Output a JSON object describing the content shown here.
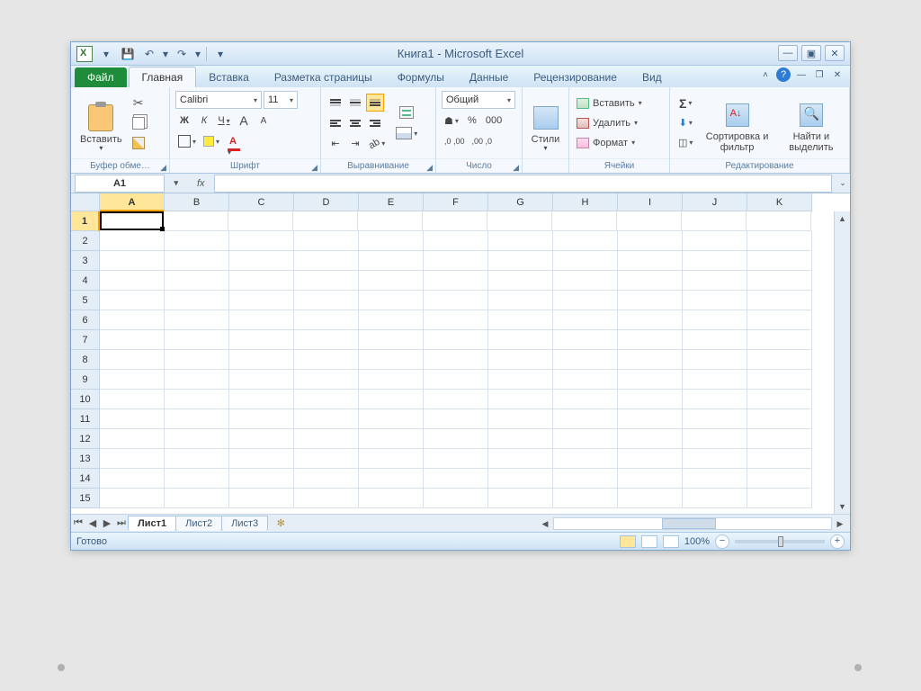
{
  "title": "Книга1  -  Microsoft Excel",
  "ribbon": {
    "tabs": {
      "file": "Файл",
      "home": "Главная",
      "insert": "Вставка",
      "page_layout": "Разметка страницы",
      "formulas": "Формулы",
      "data": "Данные",
      "review": "Рецензирование",
      "view": "Вид"
    },
    "groups": {
      "clipboard": {
        "label": "Буфер обме…",
        "paste": "Вставить"
      },
      "font": {
        "label": "Шрифт",
        "font_name": "Calibri",
        "font_size": "11",
        "bold": "Ж",
        "italic": "К",
        "underline": "Ч",
        "grow": "A",
        "shrink": "A"
      },
      "alignment": {
        "label": "Выравнивание"
      },
      "number": {
        "label": "Число",
        "format": "Общий",
        "percent": "%",
        "thousands": "000",
        "inc_dec_a": ",0←",
        "inc_dec_b": ",00→"
      },
      "styles": {
        "label": "",
        "button": "Стили"
      },
      "cells": {
        "label": "Ячейки",
        "insert": "Вставить",
        "delete": "Удалить",
        "format": "Формат"
      },
      "editing": {
        "label": "Редактирование",
        "sigma": "Σ",
        "sort": "Сортировка и фильтр",
        "find": "Найти и выделить"
      }
    }
  },
  "formula_bar": {
    "name_box": "A1",
    "fx": "fx",
    "formula": ""
  },
  "grid": {
    "columns": [
      "A",
      "B",
      "C",
      "D",
      "E",
      "F",
      "G",
      "H",
      "I",
      "J",
      "K"
    ],
    "rows": [
      "1",
      "2",
      "3",
      "4",
      "5",
      "6",
      "7",
      "8",
      "9",
      "10",
      "11",
      "12",
      "13",
      "14",
      "15"
    ],
    "active_cell": "A1"
  },
  "sheets": {
    "tabs": [
      "Лист1",
      "Лист2",
      "Лист3"
    ],
    "active": 0
  },
  "status": {
    "ready": "Готово",
    "zoom": "100%"
  }
}
